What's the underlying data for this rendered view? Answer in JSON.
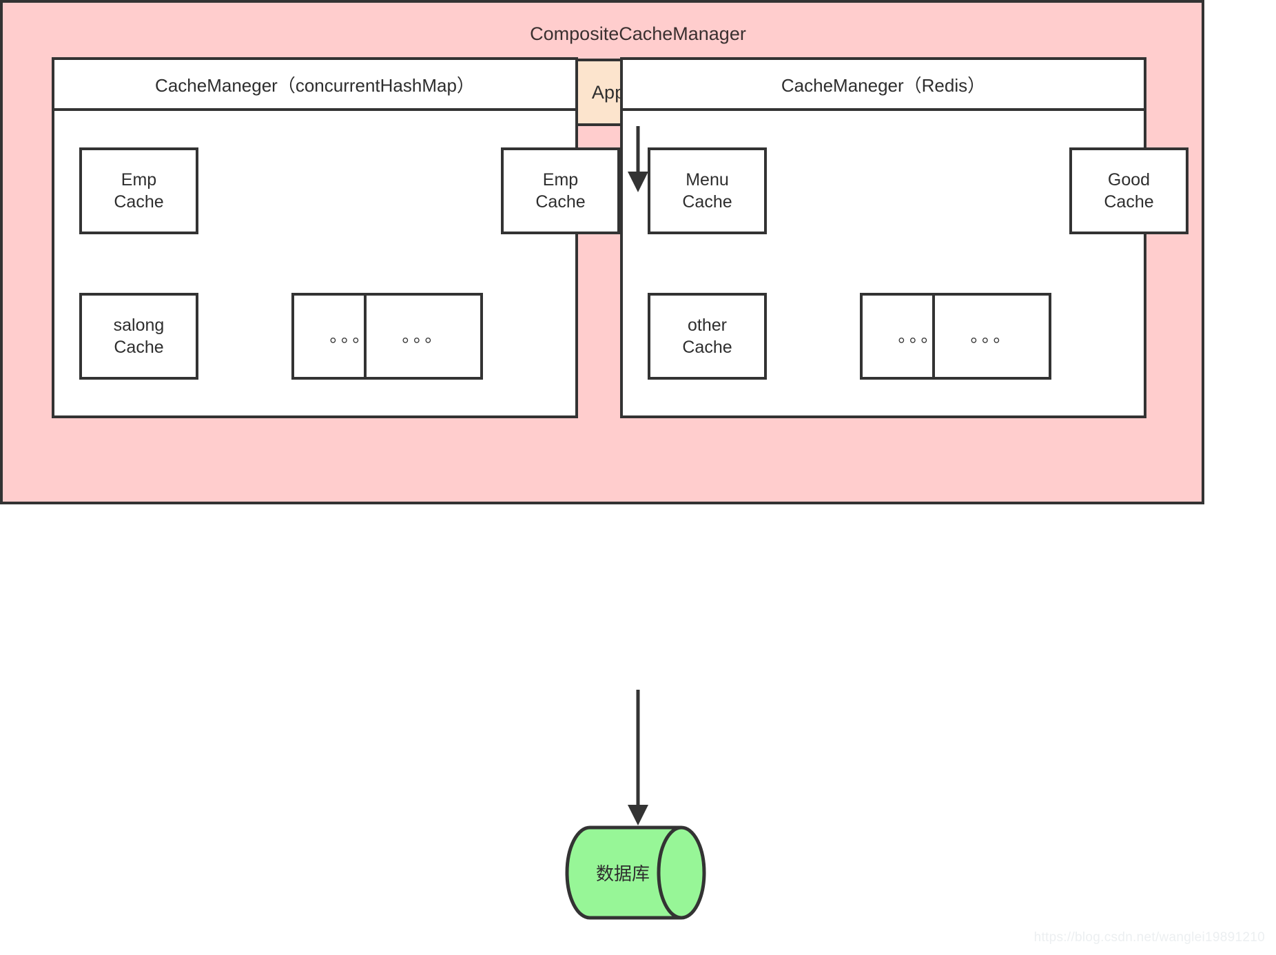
{
  "diagram": {
    "application": {
      "label": "Application",
      "fill": "#fce4cd",
      "stroke": "#333333"
    },
    "composite": {
      "title": "CompositeCacheManager",
      "fill": "#ffcdcd",
      "stroke": "#333333"
    },
    "managers": [
      {
        "id": "concurrent-hash-map",
        "header": "CacheManeger（concurrentHashMap）",
        "caches": [
          {
            "label": "Emp\nCache",
            "kind": "named",
            "row": "top",
            "col": "a"
          },
          {
            "label": "Emp\nCache",
            "kind": "named",
            "row": "top",
            "col": "d"
          },
          {
            "label": "salong\nCache",
            "kind": "named",
            "row": "bottom",
            "col": "a"
          },
          {
            "label": "。。。",
            "kind": "ellipsis",
            "row": "bottom",
            "col": "b"
          },
          {
            "label": "。。。",
            "kind": "ellipsis",
            "row": "bottom",
            "col": "c"
          }
        ]
      },
      {
        "id": "redis",
        "header": "CacheManeger（Redis）",
        "caches": [
          {
            "label": "Menu\nCache",
            "kind": "named",
            "row": "top",
            "col": "a"
          },
          {
            "label": "Good\nCache",
            "kind": "named",
            "row": "top",
            "col": "d"
          },
          {
            "label": "other\nCache",
            "kind": "named",
            "row": "bottom",
            "col": "a"
          },
          {
            "label": "。。。",
            "kind": "ellipsis",
            "row": "bottom",
            "col": "b"
          },
          {
            "label": "。。。",
            "kind": "ellipsis",
            "row": "bottom",
            "col": "c"
          }
        ]
      }
    ],
    "database": {
      "label": "数据库",
      "fill": "#97f697",
      "stroke": "#333333"
    },
    "arrows": [
      {
        "id": "application-to-composite",
        "from": "Application",
        "to": "CompositeCacheManager"
      },
      {
        "id": "composite-to-database",
        "from": "CompositeCacheManager",
        "to": "数据库"
      }
    ]
  },
  "watermark": {
    "text": "https://blog.csdn.net/wanglei19891210"
  }
}
